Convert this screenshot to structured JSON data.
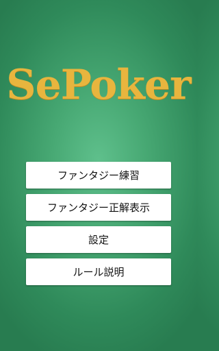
{
  "app": {
    "title": "SePoker",
    "accent_color": "#e8b53e",
    "background_color": "#3c9a68"
  },
  "menu": {
    "items": [
      {
        "label": "ファンタジー練習"
      },
      {
        "label": "ファンタジー正解表示"
      },
      {
        "label": "設定"
      },
      {
        "label": "ルール説明"
      }
    ]
  }
}
